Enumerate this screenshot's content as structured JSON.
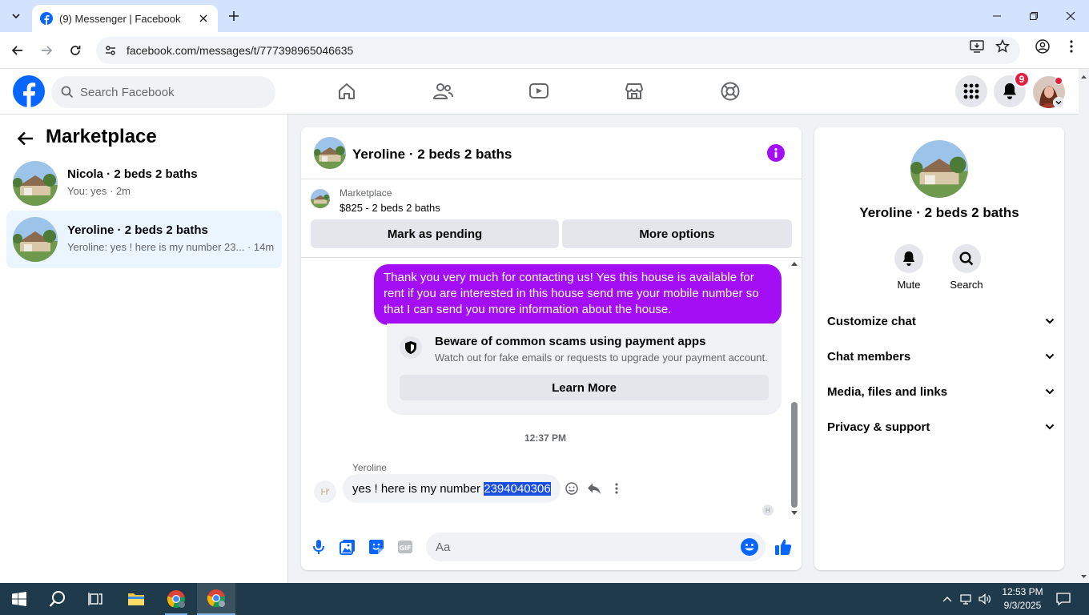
{
  "browser": {
    "tab_title": "(9) Messenger | Facebook",
    "url": "facebook.com/messages/t/777398965046635"
  },
  "header": {
    "search_placeholder": "Search Facebook",
    "notification_count": "9",
    "brand_color": "#0866ff"
  },
  "sidebar": {
    "title": "Marketplace",
    "conversations": [
      {
        "name": "Nicola · 2 beds 2 baths",
        "snippet": "You: yes · 2m",
        "active": false
      },
      {
        "name": "Yeroline · 2 beds 2 baths",
        "snippet": "Yeroline: yes ! here is my number 23... · 14m",
        "active": true
      }
    ]
  },
  "chat": {
    "title": "Yeroline · 2 beds 2 baths",
    "marketplace_label": "Marketplace",
    "listing": "$825 - 2 beds 2 baths",
    "mark_pending_label": "Mark as pending",
    "more_options_label": "More options",
    "outgoing_message": "Thank you very much for contacting us! Yes this house is available for rent if you are interested in this house send me your mobile number so that I can send you more information about the house.",
    "scam_title": "Beware of common scams using payment apps",
    "scam_subtitle": "Watch out for fake emails or requests to upgrade your payment account.",
    "learn_more_label": "Learn More",
    "timestamp": "12:37 PM",
    "sender": "Yeroline",
    "incoming_prefix": "yes ! here is my number ",
    "incoming_selected": "2394040306",
    "composer_placeholder": "Aa",
    "accent_color": "#a30ef4"
  },
  "details": {
    "name": "Yeroline · 2 beds 2 baths",
    "mute_label": "Mute",
    "search_label": "Search",
    "sections": [
      "Customize chat",
      "Chat members",
      "Media, files and links",
      "Privacy & support"
    ]
  },
  "taskbar": {
    "time": "12:53 PM",
    "date": "9/3/2025"
  }
}
